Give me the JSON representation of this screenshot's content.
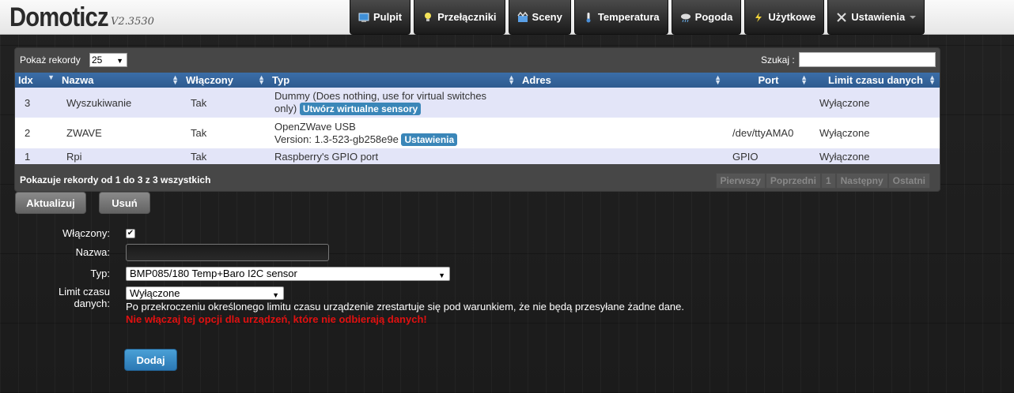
{
  "app": {
    "name": "Domoticz",
    "version": "V2.3530"
  },
  "nav": [
    {
      "label": "Pulpit",
      "icon": "dashboard-icon"
    },
    {
      "label": "Przełączniki",
      "icon": "lightbulb-icon"
    },
    {
      "label": "Sceny",
      "icon": "scenes-icon"
    },
    {
      "label": "Temperatura",
      "icon": "thermometer-icon"
    },
    {
      "label": "Pogoda",
      "icon": "weather-icon"
    },
    {
      "label": "Użytkowe",
      "icon": "utility-icon"
    },
    {
      "label": "Ustawienia",
      "icon": "settings-icon"
    }
  ],
  "table": {
    "length_label": "Pokaż rekordy",
    "length_value": "25",
    "search_label": "Szukaj :",
    "columns": [
      "Idx",
      "Nazwa",
      "Włączony",
      "Typ",
      "Adres",
      "Port",
      "Limit czasu danych"
    ],
    "rows": [
      {
        "idx": "3",
        "name": "Wyszukiwanie",
        "enabled": "Tak",
        "type_l1": "Dummy (Does nothing, use for virtual switches",
        "type_l2": "only)",
        "type_btn": "Utwórz wirtualne sensory",
        "address": "",
        "port": "",
        "timeout": "Wyłączone"
      },
      {
        "idx": "2",
        "name": "ZWAVE",
        "enabled": "Tak",
        "type_l1": "OpenZWave USB",
        "type_l2": "Version: 1.3-523-gb258e9e",
        "type_btn": "Ustawienia",
        "address": "",
        "port": "/dev/ttyAMA0",
        "timeout": "Wyłączone"
      },
      {
        "idx": "1",
        "name": "Rpi",
        "enabled": "Tak",
        "type_l1": "Raspberry's GPIO port",
        "address": "",
        "port": "GPIO",
        "timeout": "Wyłączone"
      }
    ],
    "info": "Pokazuje rekordy od 1 do 3 z 3 wszystkich",
    "pager": [
      "Pierwszy",
      "Poprzedni",
      "1",
      "Następny",
      "Ostatni"
    ]
  },
  "actions": {
    "update": "Aktualizuj",
    "delete": "Usuń"
  },
  "form": {
    "enabled_label": "Włączony:",
    "name_label": "Nazwa:",
    "type_label": "Typ:",
    "type_value": "BMP085/180 Temp+Baro I2C sensor",
    "timeout_label_1": "Limit czasu",
    "timeout_label_2": "danych:",
    "timeout_value": "Wyłączone",
    "help_text": "Po przekroczeniu określonego limitu czasu urządzenie zrestartuje się pod warunkiem, że nie będą przesyłane żadne dane.",
    "warning_text": "Nie włączaj tej opcji dla urządzeń, które nie odbierają danych!",
    "add_label": "Dodaj"
  },
  "colors": {
    "header_blue": "#2e5b8f",
    "row_highlight": "#e3e5f8",
    "warning": "#e01010",
    "tag": "#3a86b8"
  }
}
